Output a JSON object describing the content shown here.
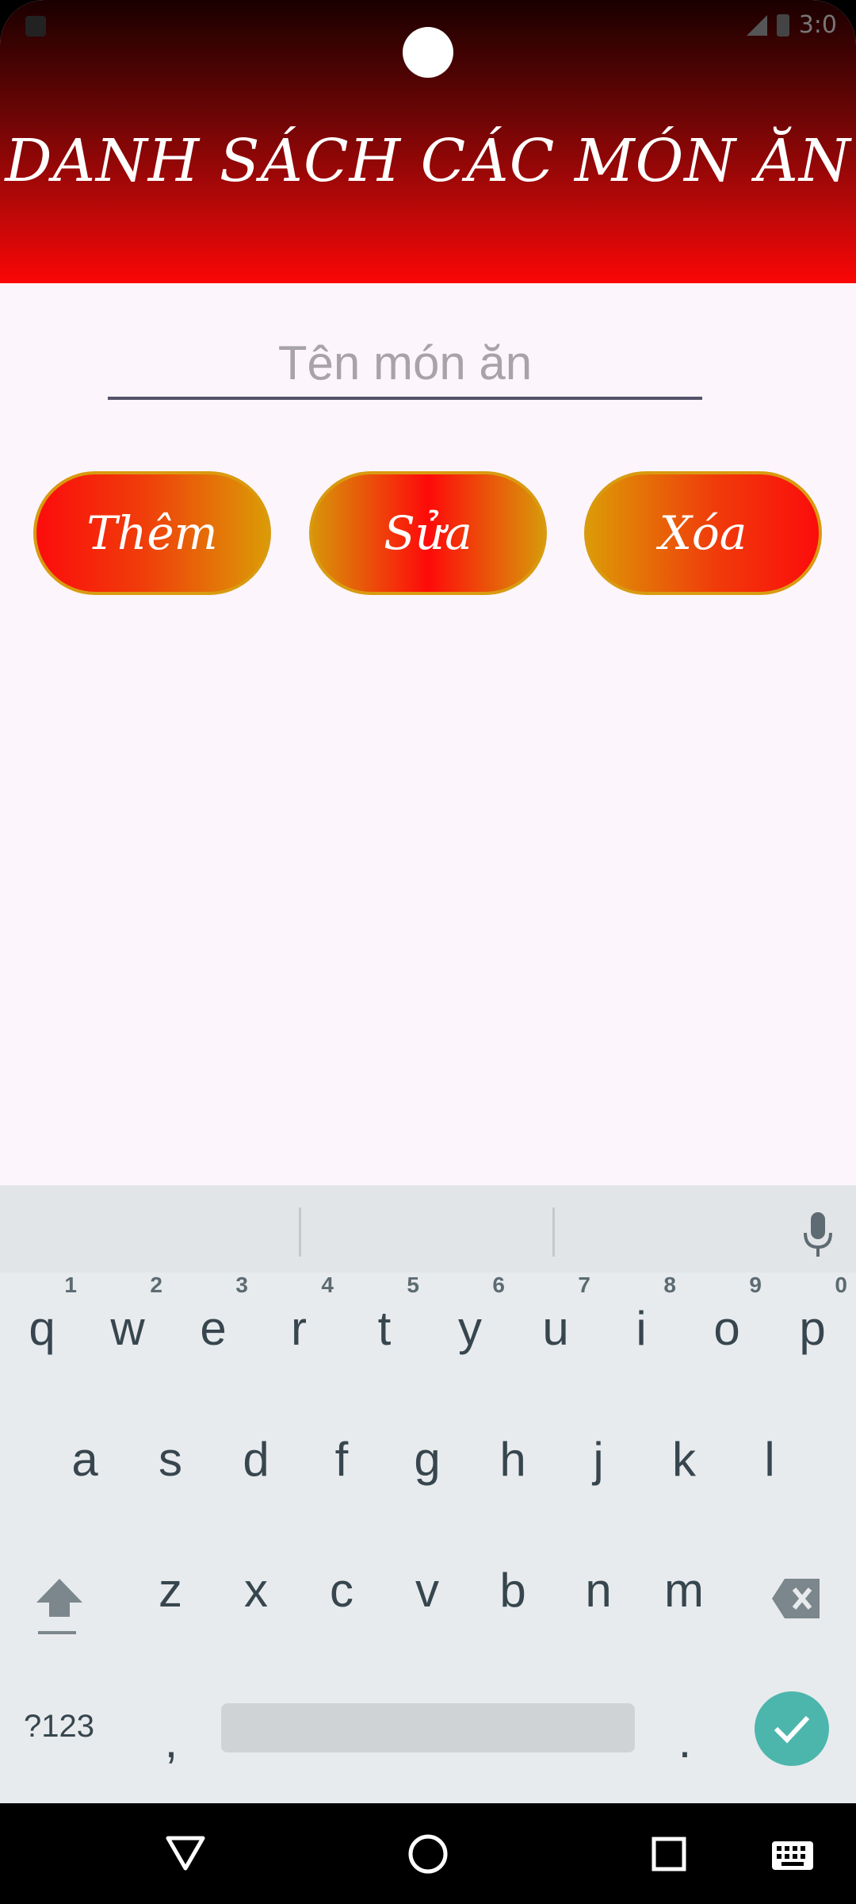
{
  "status_bar": {
    "time": "3:0"
  },
  "header": {
    "title": "DANH SÁCH CÁC MÓN ĂN"
  },
  "form": {
    "name_input": {
      "value": "",
      "placeholder": "Tên món ăn"
    }
  },
  "buttons": {
    "add": "Thêm",
    "edit": "Sửa",
    "delete": "Xóa"
  },
  "keyboard": {
    "row1": [
      {
        "key": "q",
        "hint": "1"
      },
      {
        "key": "w",
        "hint": "2"
      },
      {
        "key": "e",
        "hint": "3"
      },
      {
        "key": "r",
        "hint": "4"
      },
      {
        "key": "t",
        "hint": "5"
      },
      {
        "key": "y",
        "hint": "6"
      },
      {
        "key": "u",
        "hint": "7"
      },
      {
        "key": "i",
        "hint": "8"
      },
      {
        "key": "o",
        "hint": "9"
      },
      {
        "key": "p",
        "hint": "0"
      }
    ],
    "row2": [
      "a",
      "s",
      "d",
      "f",
      "g",
      "h",
      "j",
      "k",
      "l"
    ],
    "row3": [
      "z",
      "x",
      "c",
      "v",
      "b",
      "n",
      "m"
    ],
    "symbols": "?123",
    "comma": ",",
    "period": "."
  },
  "colors": {
    "header_dark": "#1a0000",
    "header_red": "#fb0606",
    "button_red": "#fc0c0c",
    "button_gold": "#dc9a06",
    "screen_bg": "#fcf5fb",
    "enter_key": "#4db6ac"
  }
}
